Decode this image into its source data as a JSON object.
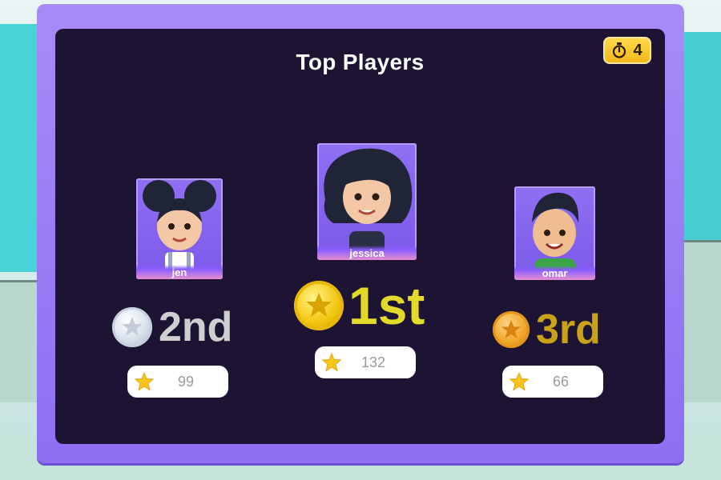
{
  "title": "Top Players",
  "timer": {
    "icon": "stopwatch-icon",
    "value": "4"
  },
  "players": [
    {
      "name": "jen",
      "rank": "2nd",
      "score": "99",
      "medal": "silver-coin-icon",
      "rank_color": "#cfcfcf"
    },
    {
      "name": "jessica",
      "rank": "1st",
      "score": "132",
      "medal": "gold-coin-icon",
      "rank_color": "#e3d92a"
    },
    {
      "name": "omar",
      "rank": "3rd",
      "score": "66",
      "medal": "bronze-coin-icon",
      "rank_color": "#c9a21a"
    }
  ],
  "colors": {
    "frame": "#9a7af5",
    "panel": "#1d1333",
    "timer": "#f7c42c",
    "gold": "#f2c611",
    "silver": "#dfe6ef",
    "bronze": "#f0a62a"
  }
}
